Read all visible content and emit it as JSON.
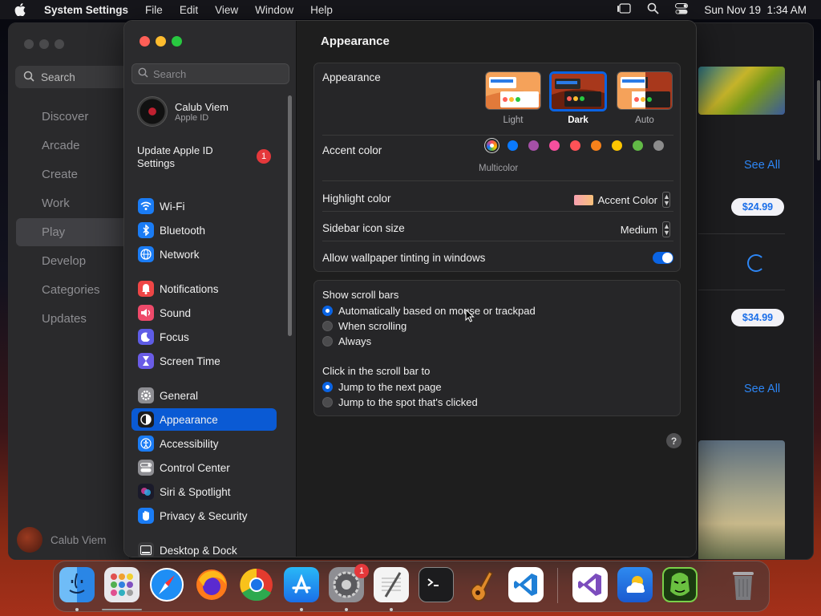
{
  "menubar": {
    "app_name": "System Settings",
    "menus": [
      "File",
      "Edit",
      "View",
      "Window",
      "Help"
    ],
    "datetime": "Sun Nov 19  1:34 AM"
  },
  "store": {
    "search_placeholder": "Search",
    "nav": [
      "Discover",
      "Arcade",
      "Create",
      "Work",
      "Play",
      "Develop",
      "Categories",
      "Updates"
    ],
    "selected_nav": "Play",
    "user_name": "Calub Viem",
    "see_all": "See All",
    "prices": [
      "$24.99",
      "$34.99"
    ]
  },
  "settings": {
    "search_placeholder": "Search",
    "account": {
      "name": "Calub Viem",
      "subtitle": "Apple ID"
    },
    "update": {
      "label": "Update Apple ID Settings",
      "badge": "1"
    },
    "sidebar": [
      {
        "label": "Wi-Fi",
        "icon": "wifi-icon",
        "color": "#1a7cf5"
      },
      {
        "label": "Bluetooth",
        "icon": "bluetooth-icon",
        "color": "#1a7cf5"
      },
      {
        "label": "Network",
        "icon": "globe-icon",
        "color": "#1a7cf5"
      },
      {
        "label": "Notifications",
        "icon": "bell-icon",
        "color": "#ee4646"
      },
      {
        "label": "Sound",
        "icon": "speaker-icon",
        "color": "#ee4a6a"
      },
      {
        "label": "Focus",
        "icon": "moon-icon",
        "color": "#5e5ce6"
      },
      {
        "label": "Screen Time",
        "icon": "hourglass-icon",
        "color": "#6a5ce6"
      },
      {
        "label": "General",
        "icon": "gear-icon",
        "color": "#8e8e93"
      },
      {
        "label": "Appearance",
        "icon": "appearance-icon",
        "color": "#1c1c1e"
      },
      {
        "label": "Accessibility",
        "icon": "accessibility-icon",
        "color": "#1a7cf5"
      },
      {
        "label": "Control Center",
        "icon": "control-center-icon",
        "color": "#8e8e93"
      },
      {
        "label": "Siri & Spotlight",
        "icon": "siri-icon",
        "color": "#b03ad0"
      },
      {
        "label": "Privacy & Security",
        "icon": "hand-icon",
        "color": "#1a7cf5"
      },
      {
        "label": "Desktop & Dock",
        "icon": "dock-icon",
        "color": "#3a3a3c"
      }
    ],
    "selected": "Appearance"
  },
  "appearance": {
    "title": "Appearance",
    "appearance_label": "Appearance",
    "modes": [
      "Light",
      "Dark",
      "Auto"
    ],
    "selected_mode": "Dark",
    "accent_label": "Accent color",
    "accent_colors": [
      "#ffffff",
      "#0a7aff",
      "#a550a7",
      "#f74f9e",
      "#ff5257",
      "#f7821b",
      "#ffc600",
      "#62ba46",
      "#8c8c8c"
    ],
    "accent_selected_caption": "Multicolor",
    "highlight_label": "Highlight color",
    "highlight_value": "Accent Color",
    "icon_size_label": "Sidebar icon size",
    "icon_size_value": "Medium",
    "tinting_label": "Allow wallpaper tinting in windows",
    "tinting_on": true,
    "scroll_bars_label": "Show scroll bars",
    "scroll_bar_options": [
      "Automatically based on mouse or trackpad",
      "When scrolling",
      "Always"
    ],
    "click_label": "Click in the scroll bar to",
    "click_options": [
      "Jump to the next page",
      "Jump to the spot that's clicked"
    ],
    "help": "?"
  },
  "dock": {
    "apps": [
      "Finder",
      "Launchpad",
      "Safari",
      "Firefox",
      "Chrome",
      "App Store",
      "System Settings",
      "TextEdit",
      "Terminal",
      "GarageBand",
      "VS Code",
      "Visual Studio",
      "Weather",
      "Hacker App",
      "Trash"
    ],
    "settings_badge": "1"
  }
}
